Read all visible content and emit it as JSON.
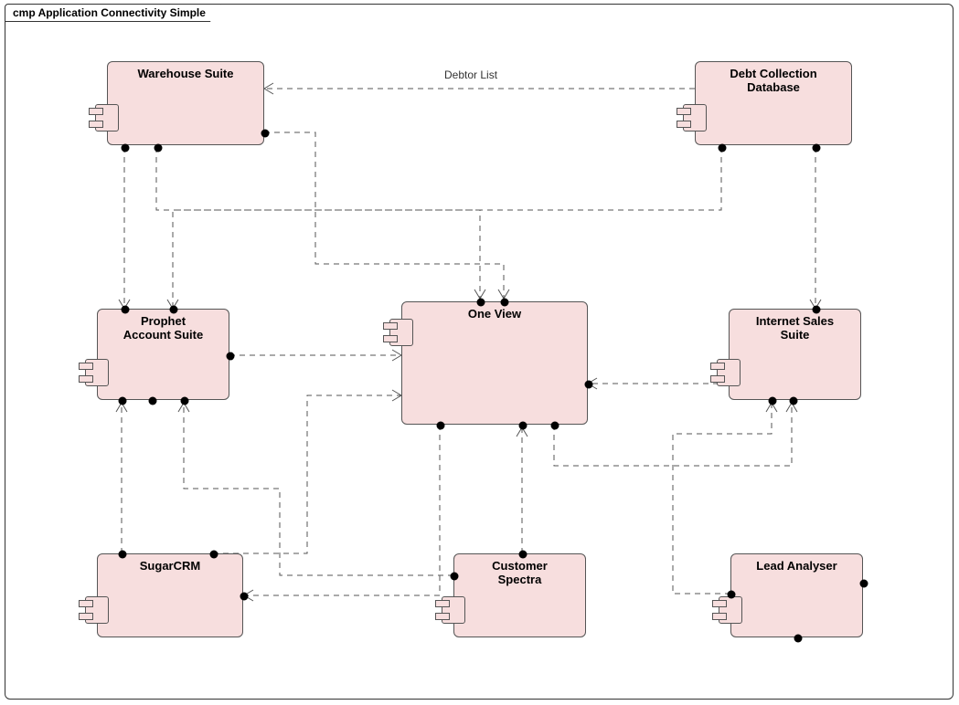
{
  "frame": {
    "title": "cmp Application Connectivity Simple"
  },
  "labels": {
    "debtorList": "Debtor List"
  },
  "components": {
    "warehouse": {
      "title": "Warehouse Suite"
    },
    "dcdb": {
      "title": "Debt Collection\nDatabase"
    },
    "prophet": {
      "title": "Prophet\nAccount Suite"
    },
    "oneview": {
      "title": "One View"
    },
    "internet": {
      "title": "Internet Sales\nSuite"
    },
    "sugarcrm": {
      "title": "SugarCRM"
    },
    "spectra": {
      "title": "Customer\nSpectra"
    },
    "lead": {
      "title": "Lead Analyser"
    }
  }
}
